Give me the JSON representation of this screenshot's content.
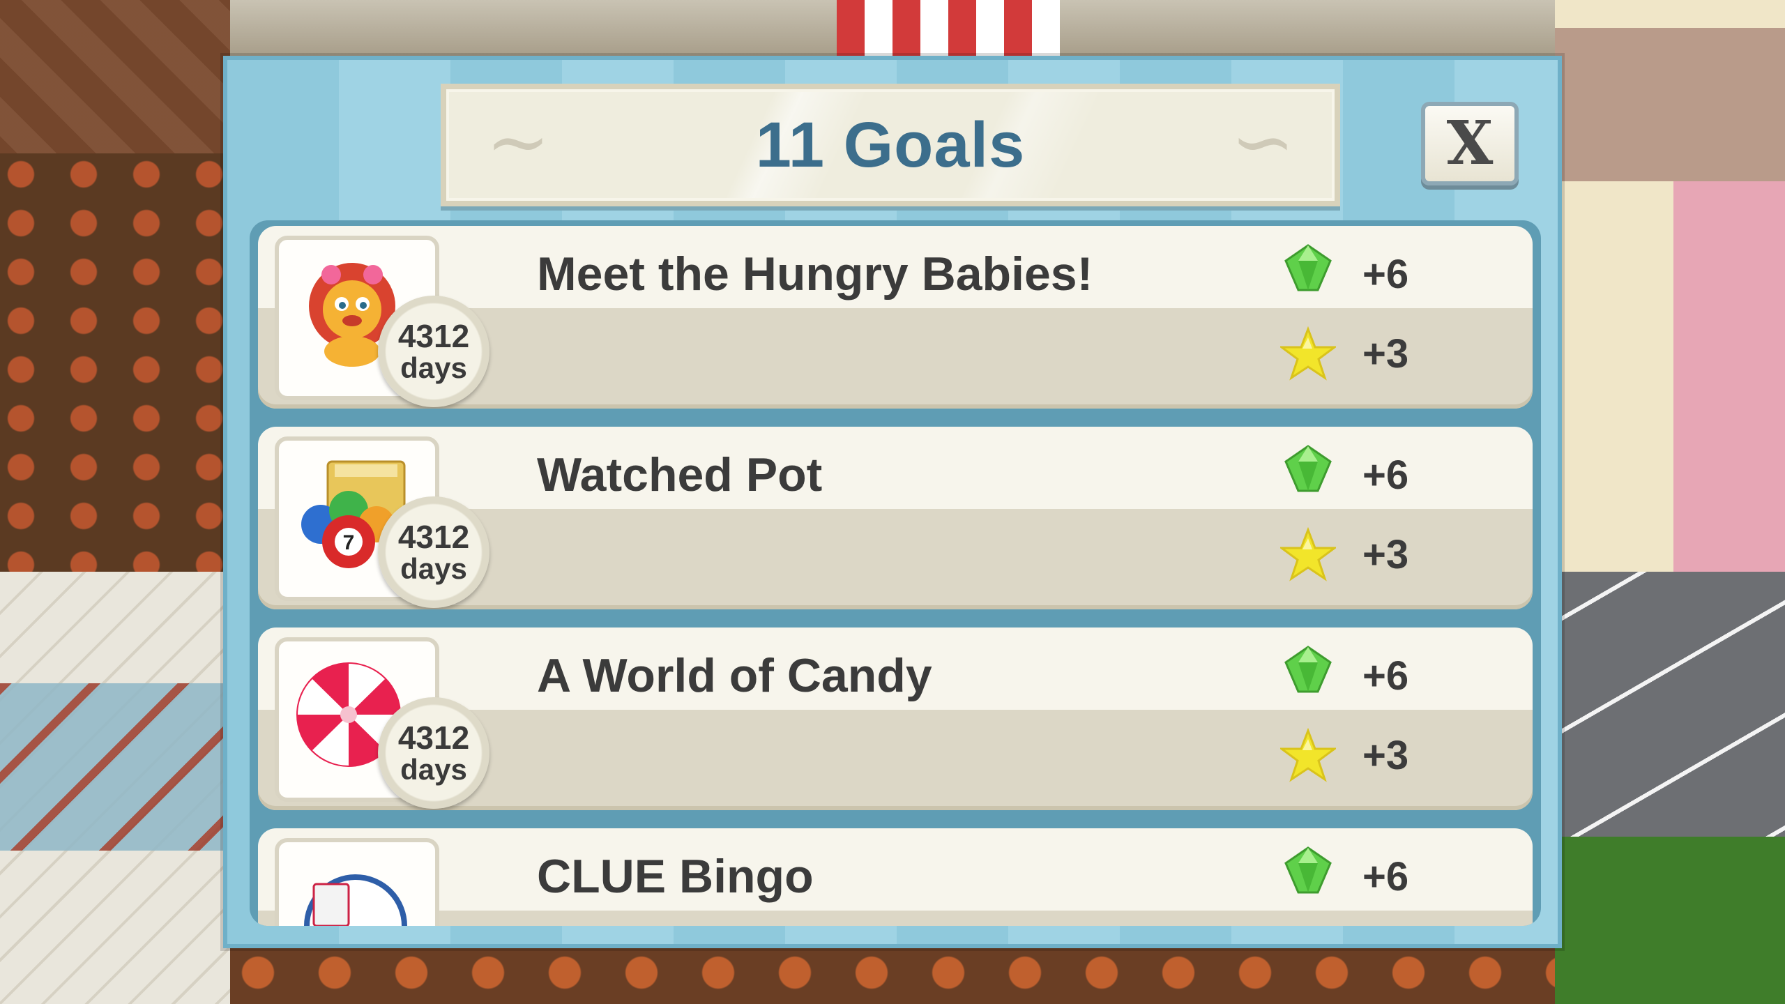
{
  "dialog": {
    "title": "11 Goals",
    "close_label": "X"
  },
  "goals": [
    {
      "title": "Meet the Hungry Babies!",
      "icon": "lion-icon",
      "timer_value": "4312",
      "timer_unit": "days",
      "gem_reward": "+6",
      "star_reward": "+3"
    },
    {
      "title": "Watched Pot",
      "icon": "bingo-balls-icon",
      "timer_value": "4312",
      "timer_unit": "days",
      "gem_reward": "+6",
      "star_reward": "+3"
    },
    {
      "title": "A World of Candy",
      "icon": "peppermint-candy-icon",
      "timer_value": "4312",
      "timer_unit": "days",
      "gem_reward": "+6",
      "star_reward": "+3"
    },
    {
      "title": "CLUE Bingo",
      "icon": "bingo-card-icon",
      "gem_reward": "+6"
    }
  ],
  "colors": {
    "dialog_bg": "#9fd3e4",
    "title_text": "#3c6e8c",
    "gem": "#5fd04a",
    "star": "#f2e52a"
  }
}
